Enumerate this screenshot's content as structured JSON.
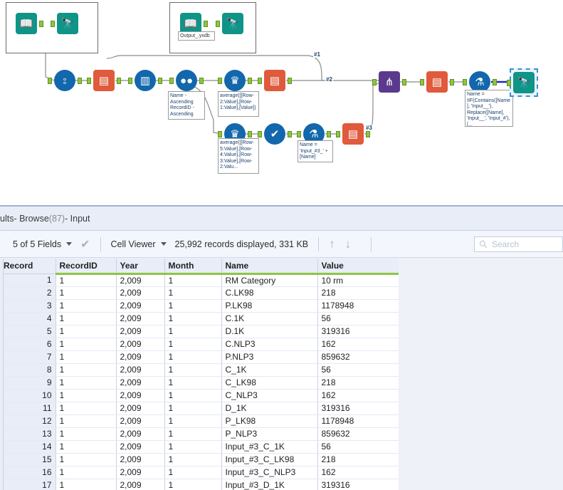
{
  "canvas": {
    "containers": [
      {
        "label": ""
      },
      {
        "label": ""
      }
    ],
    "output_label": "Output_.yxdb",
    "tools": [
      {
        "name": "input-data-tool",
        "icon": "book-icon"
      },
      {
        "name": "browse-tool",
        "icon": "binoculars-icon"
      },
      {
        "name": "input-data-tool-2",
        "icon": "book-icon"
      },
      {
        "name": "browse-tool-2",
        "icon": "binoculars-icon"
      },
      {
        "name": "transpose-tool",
        "icon": "transpose-icon"
      },
      {
        "name": "select-tool",
        "icon": "select-icon"
      },
      {
        "name": "sort-tool",
        "icon": "sort-icon"
      },
      {
        "name": "summarize-tool",
        "icon": "summarize-icon"
      },
      {
        "name": "multi-row-formula-tool",
        "icon": "crown-icon"
      },
      {
        "name": "select-tool-2",
        "icon": "select-icon"
      },
      {
        "name": "multi-row-formula-tool-2",
        "icon": "crown-icon"
      },
      {
        "name": "filter-tool",
        "icon": "check-icon"
      },
      {
        "name": "formula-tool",
        "icon": "flask-icon"
      },
      {
        "name": "select-tool-3",
        "icon": "select-icon"
      },
      {
        "name": "union-tool",
        "icon": "union-icon"
      },
      {
        "name": "sort-tool-2",
        "icon": "sort-icon"
      },
      {
        "name": "formula-tool-2",
        "icon": "flask-icon"
      },
      {
        "name": "browse-tool-selected",
        "icon": "binoculars-icon"
      }
    ],
    "annotations": {
      "sort_config": "Name - Ascending RecordID - Ascending",
      "multirow_1": "average([[Row-2:Value],[Row-1:Value],[Value])",
      "multirow_2": "average([[Row-5:Value],[Row-4:Value],[Row-3:Value],[Row-2:Valu...",
      "formula_1": "Name = 'Input_#3_' + [Name]",
      "formula_2": "Name = IIF(Contains([Name], 'Input__'), Replace([Name], 'Input__', 'Input_#'), [..."
    },
    "wire_labels": [
      "#1",
      "#2",
      "#3"
    ]
  },
  "results": {
    "title_prefix": "ults",
    "title_sep1": " - Browse ",
    "title_count": "(87)",
    "title_sep2": " - Input",
    "toolbar": {
      "fields_label": "5 of 5 Fields",
      "check_icon": "checkmark-icon",
      "view_mode": "Cell Viewer",
      "record_status": "25,992 records displayed, 331 KB",
      "up_arrow": "↑",
      "down_arrow": "↓"
    },
    "search": {
      "placeholder": "Search",
      "value": "",
      "icon": "search-icon"
    },
    "grid": {
      "columns": [
        "Record",
        "RecordID",
        "Year",
        "Month",
        "Name",
        "Value"
      ],
      "rows": [
        [
          "1",
          "1",
          "2,009",
          "1",
          "RM Category",
          "10 rm"
        ],
        [
          "2",
          "1",
          "2,009",
          "1",
          "C.LK98",
          "218"
        ],
        [
          "3",
          "1",
          "2,009",
          "1",
          "P.LK98",
          "1178948"
        ],
        [
          "4",
          "1",
          "2,009",
          "1",
          "C.1K",
          "56"
        ],
        [
          "5",
          "1",
          "2,009",
          "1",
          "D.1K",
          "319316"
        ],
        [
          "6",
          "1",
          "2,009",
          "1",
          "C.NLP3",
          "162"
        ],
        [
          "7",
          "1",
          "2,009",
          "1",
          "P.NLP3",
          "859632"
        ],
        [
          "8",
          "1",
          "2,009",
          "1",
          "C_1K",
          "56"
        ],
        [
          "9",
          "1",
          "2,009",
          "1",
          "C_LK98",
          "218"
        ],
        [
          "10",
          "1",
          "2,009",
          "1",
          "C_NLP3",
          "162"
        ],
        [
          "11",
          "1",
          "2,009",
          "1",
          "D_1K",
          "319316"
        ],
        [
          "12",
          "1",
          "2,009",
          "1",
          "P_LK98",
          "1178948"
        ],
        [
          "13",
          "1",
          "2,009",
          "1",
          "P_NLP3",
          "859632"
        ],
        [
          "14",
          "1",
          "2,009",
          "1",
          "Input_#3_C_1K",
          "56"
        ],
        [
          "15",
          "1",
          "2,009",
          "1",
          "Input_#3_C_LK98",
          "218"
        ],
        [
          "16",
          "1",
          "2,009",
          "1",
          "Input_#3_C_NLP3",
          "162"
        ],
        [
          "17",
          "1",
          "2,009",
          "1",
          "Input_#3_D_1K",
          "319316"
        ]
      ]
    }
  },
  "colors": {
    "teal": "#0f9488",
    "blue": "#1267ad",
    "orange": "#e05a3c",
    "purple": "#5b3a8e",
    "green_port": "#8dc63f",
    "accent_header": "#8dc63f"
  }
}
